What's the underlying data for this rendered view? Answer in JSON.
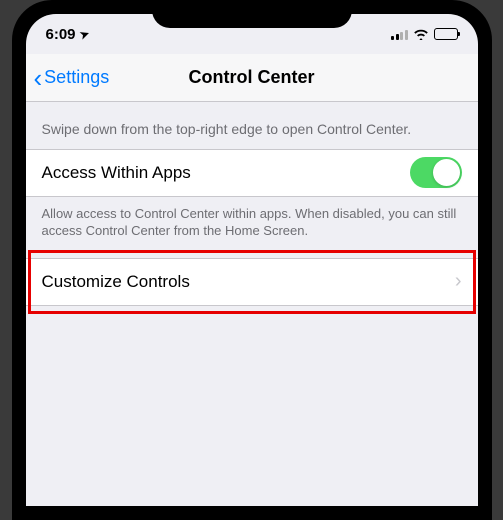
{
  "status": {
    "time": "6:09",
    "location_icon": "➤"
  },
  "nav": {
    "back_label": "Settings",
    "title": "Control Center"
  },
  "sections": {
    "intro_text": "Swipe down from the top-right edge to open Control Center.",
    "access_within_apps": {
      "label": "Access Within Apps",
      "toggle_on": true
    },
    "access_footer": "Allow access to Control Center within apps. When disabled, you can still access Control Center from the Home Screen.",
    "customize": {
      "label": "Customize Controls"
    }
  }
}
